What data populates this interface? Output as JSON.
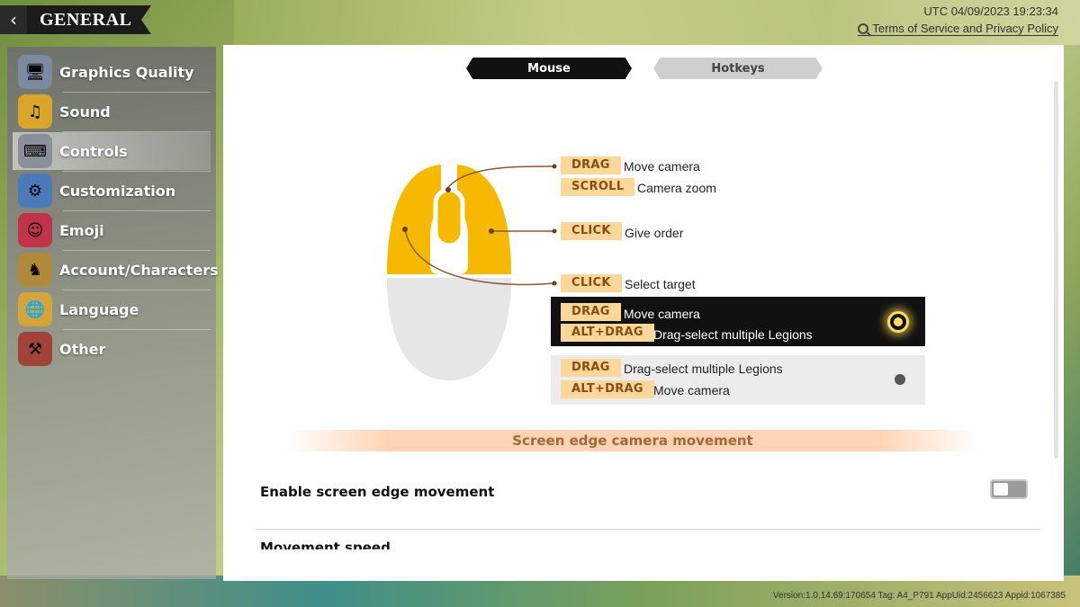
{
  "header": {
    "back_icon": "chevron-left-icon",
    "title": "GENERAL",
    "utc_time": "UTC 04/09/2023 19:23:34",
    "tos_link": "Terms of Service and Privacy Policy"
  },
  "sidebar": {
    "items": [
      {
        "label": "Graphics Quality",
        "icon": "graphics-icon"
      },
      {
        "label": "Sound",
        "icon": "sound-icon"
      },
      {
        "label": "Controls",
        "icon": "controls-icon",
        "active": true
      },
      {
        "label": "Customization",
        "icon": "customization-icon"
      },
      {
        "label": "Emoji",
        "icon": "emoji-icon"
      },
      {
        "label": "Account/Characters",
        "icon": "account-icon"
      },
      {
        "label": "Language",
        "icon": "language-icon"
      },
      {
        "label": "Other",
        "icon": "other-icon"
      }
    ]
  },
  "tabs": {
    "mouse": "Mouse",
    "hotkeys": "Hotkeys",
    "active": "Mouse"
  },
  "mouse_map": {
    "middle": [
      {
        "key": "DRAG",
        "action": "Move camera"
      },
      {
        "key": "SCROLL",
        "action": "Camera zoom"
      }
    ],
    "right": [
      {
        "key": "CLICK",
        "action": "Give order"
      }
    ],
    "left": [
      {
        "key": "CLICK",
        "action": "Select target"
      }
    ],
    "option_1": [
      {
        "key": "DRAG",
        "action": "Move camera"
      },
      {
        "key": "ALT+DRAG",
        "action": "Drag-select multiple Legions"
      }
    ],
    "option_2": [
      {
        "key": "DRAG",
        "action": "Drag-select multiple Legions"
      },
      {
        "key": "ALT+DRAG",
        "action": "Move camera"
      }
    ],
    "selected_option": 1
  },
  "settings": {
    "section_title": "Screen edge camera movement",
    "enable_edge_label": "Enable screen edge movement",
    "enable_edge_value": false,
    "movement_speed_label": "Movement speed"
  },
  "colors": {
    "mouse_top": "#f6b900",
    "key_pill": "#fbd89a",
    "key_text": "#8a4b12"
  },
  "version": "Version:1.0.14.69:170654 Tag: A4_P791 AppUid:2456623 Appid:1067385"
}
